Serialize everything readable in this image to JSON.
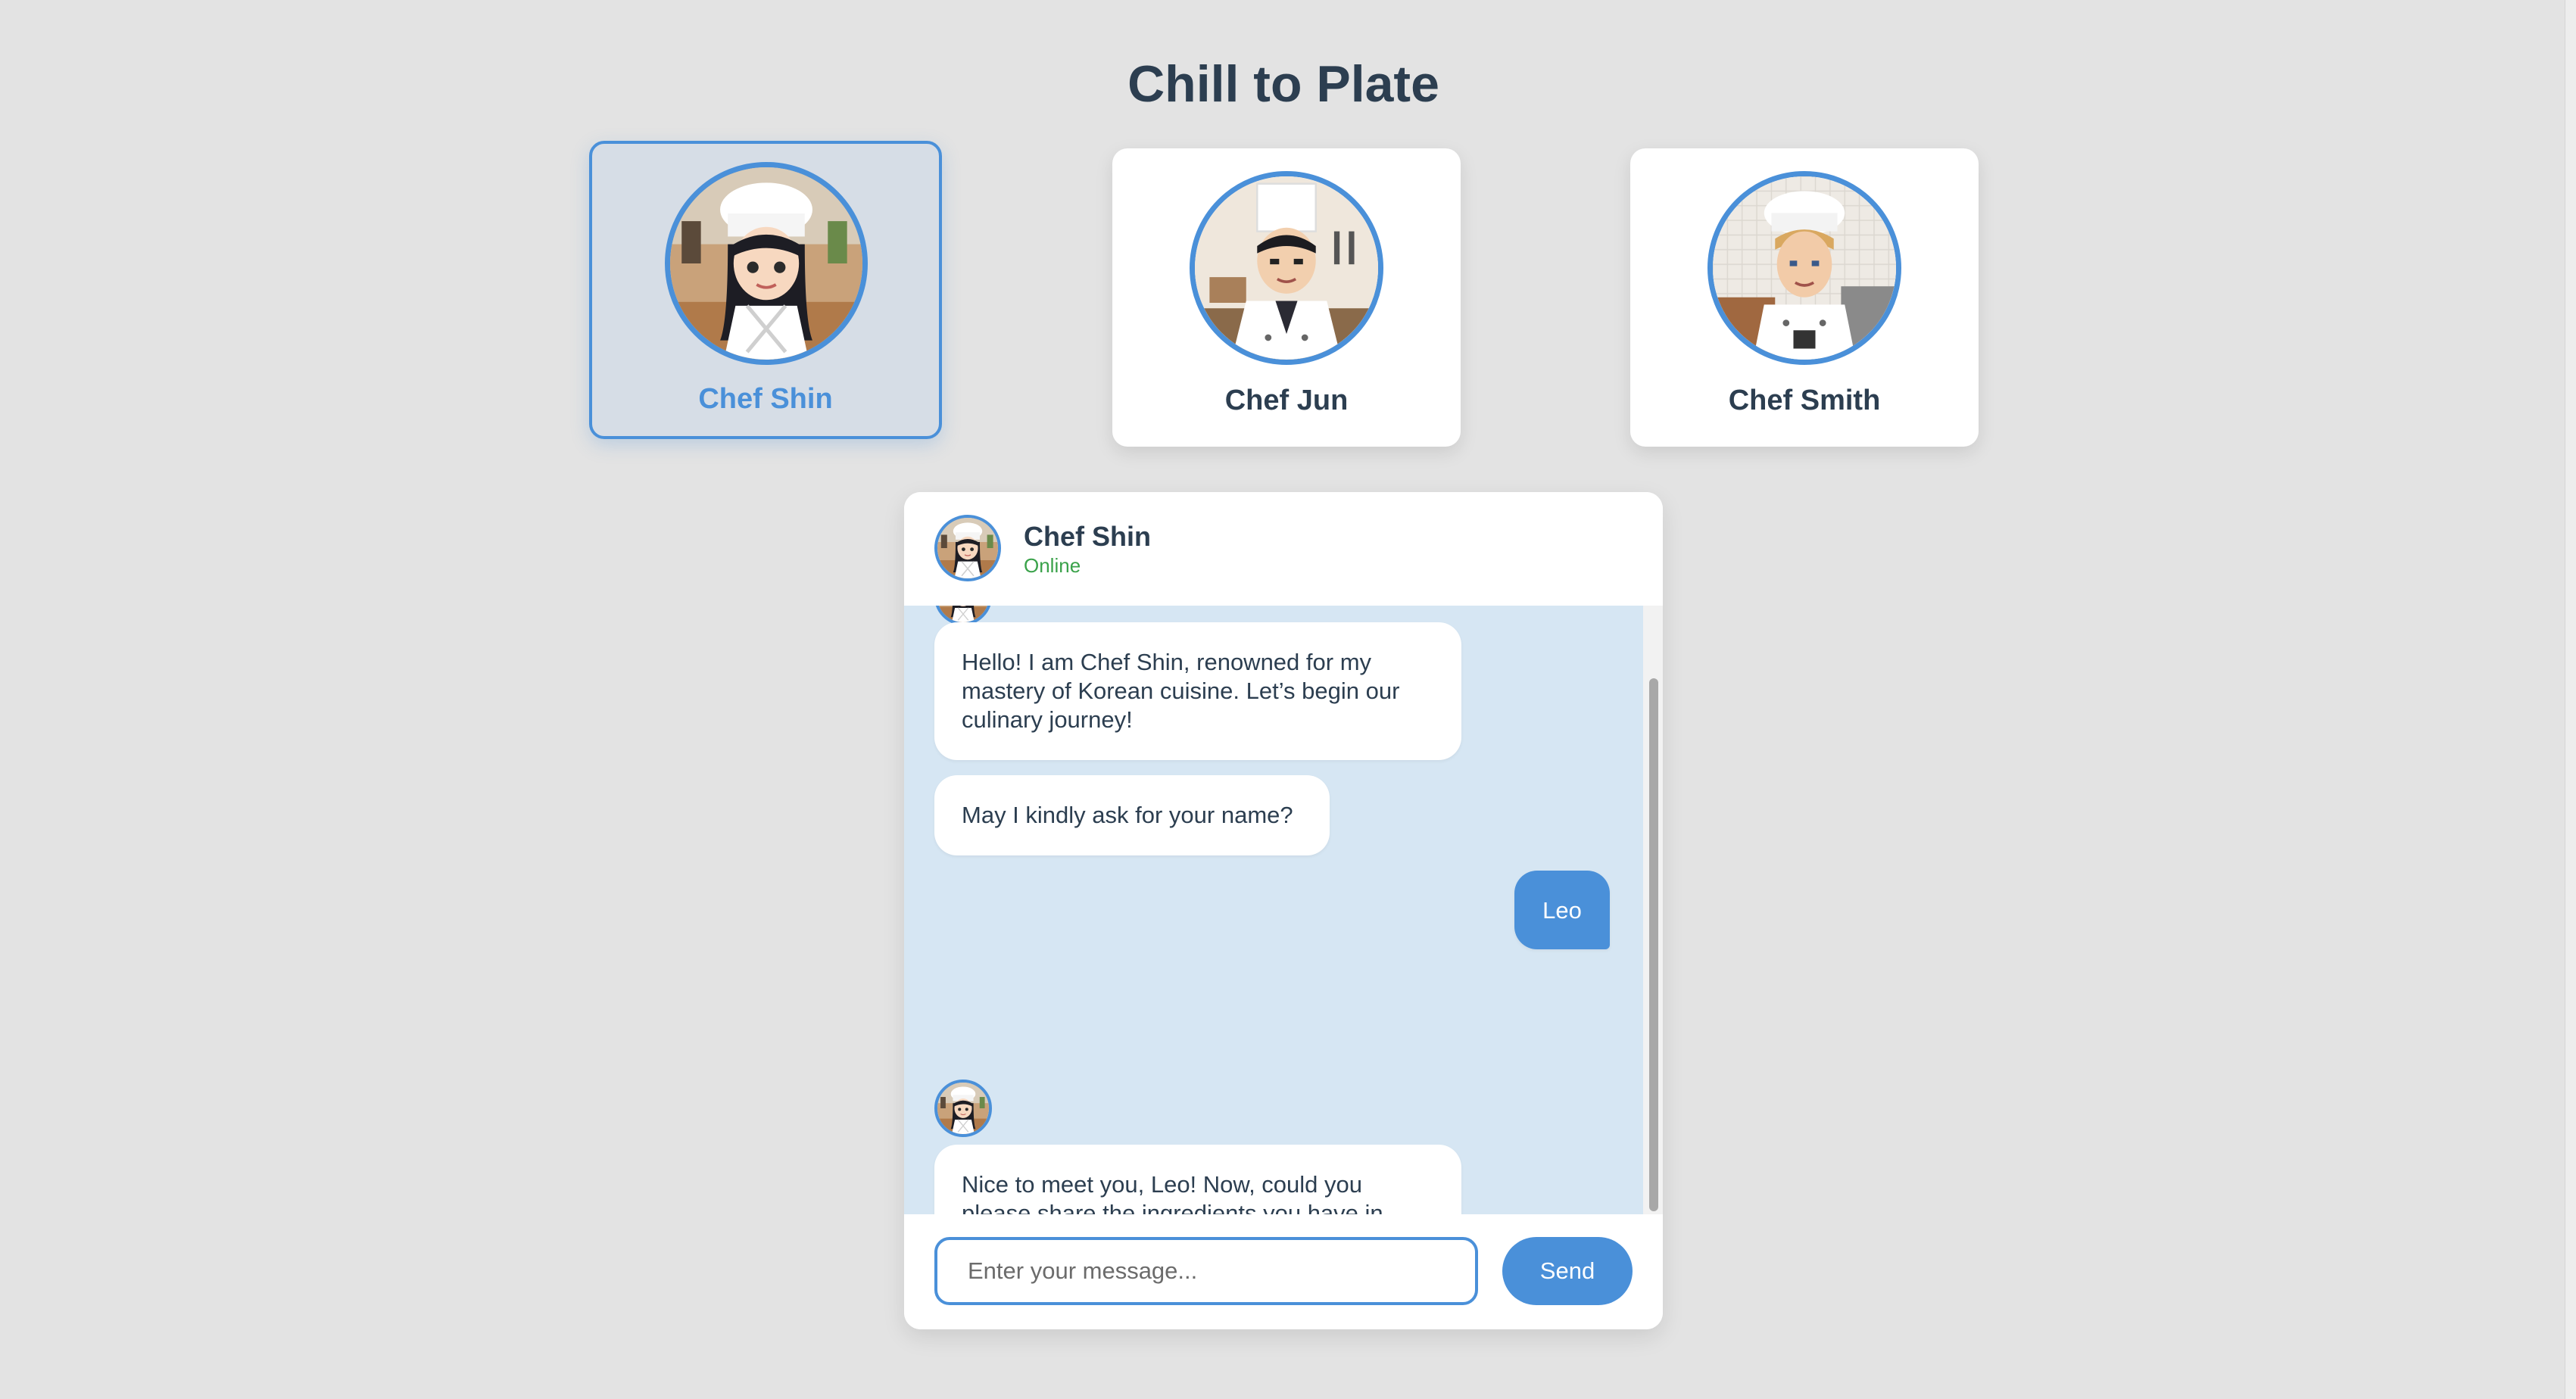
{
  "page": {
    "title": "Chill to Plate"
  },
  "chefs": [
    {
      "name": "Chef Shin",
      "active": true
    },
    {
      "name": "Chef Jun",
      "active": false
    },
    {
      "name": "Chef Smith",
      "active": false
    }
  ],
  "chat": {
    "header": {
      "name": "Chef Shin",
      "status": "Online"
    },
    "messages": [
      {
        "sender": "chef",
        "text": "Hello! I am Chef Shin, renowned for my mastery of Korean cuisine. Let’s begin our culinary journey!"
      },
      {
        "sender": "chef",
        "text": "May I kindly ask for your name?"
      },
      {
        "sender": "user",
        "text": "Leo"
      },
      {
        "sender": "chef",
        "text": "Nice to meet you, Leo! Now, could you please share the ingredients you have in your refrigerator?"
      }
    ],
    "input": {
      "placeholder": "Enter your message...",
      "value": ""
    },
    "send_label": "Send"
  },
  "colors": {
    "accent": "#4a90d9",
    "background": "#e3e3e3",
    "chat_background": "#d6e6f3",
    "status_online": "#3aa24a",
    "title": "#2c3e50"
  }
}
